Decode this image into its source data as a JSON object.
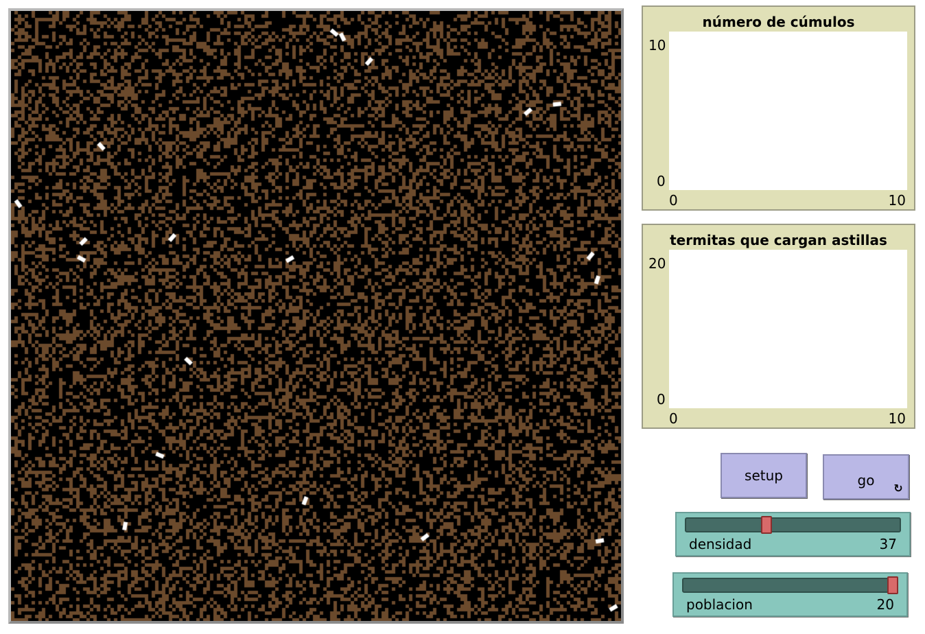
{
  "world": {
    "background_color": "#000000",
    "patch_color": "#6b4a2c",
    "turtle_color": "#ffffff"
  },
  "plots": [
    {
      "title": "número de cúmulos",
      "y_max": "10",
      "y_min": "0",
      "x_min": "0",
      "x_max": "10"
    },
    {
      "title": "termitas que cargan astillas",
      "y_max": "20",
      "y_min": "0",
      "x_min": "0",
      "x_max": "10"
    }
  ],
  "buttons": {
    "setup_label": "setup",
    "go_label": "go",
    "go_forever_icon": "forever-arrows-icon"
  },
  "sliders": [
    {
      "label": "densidad",
      "value": "37",
      "fraction": 0.37
    },
    {
      "label": "poblacion",
      "value": "20",
      "fraction": 1.0
    }
  ],
  "colors": {
    "plot_bg": "#e0e0b7",
    "button_bg": "#bab8e6",
    "slider_bg": "#88c7bd",
    "slider_thumb": "#d86a6a"
  }
}
